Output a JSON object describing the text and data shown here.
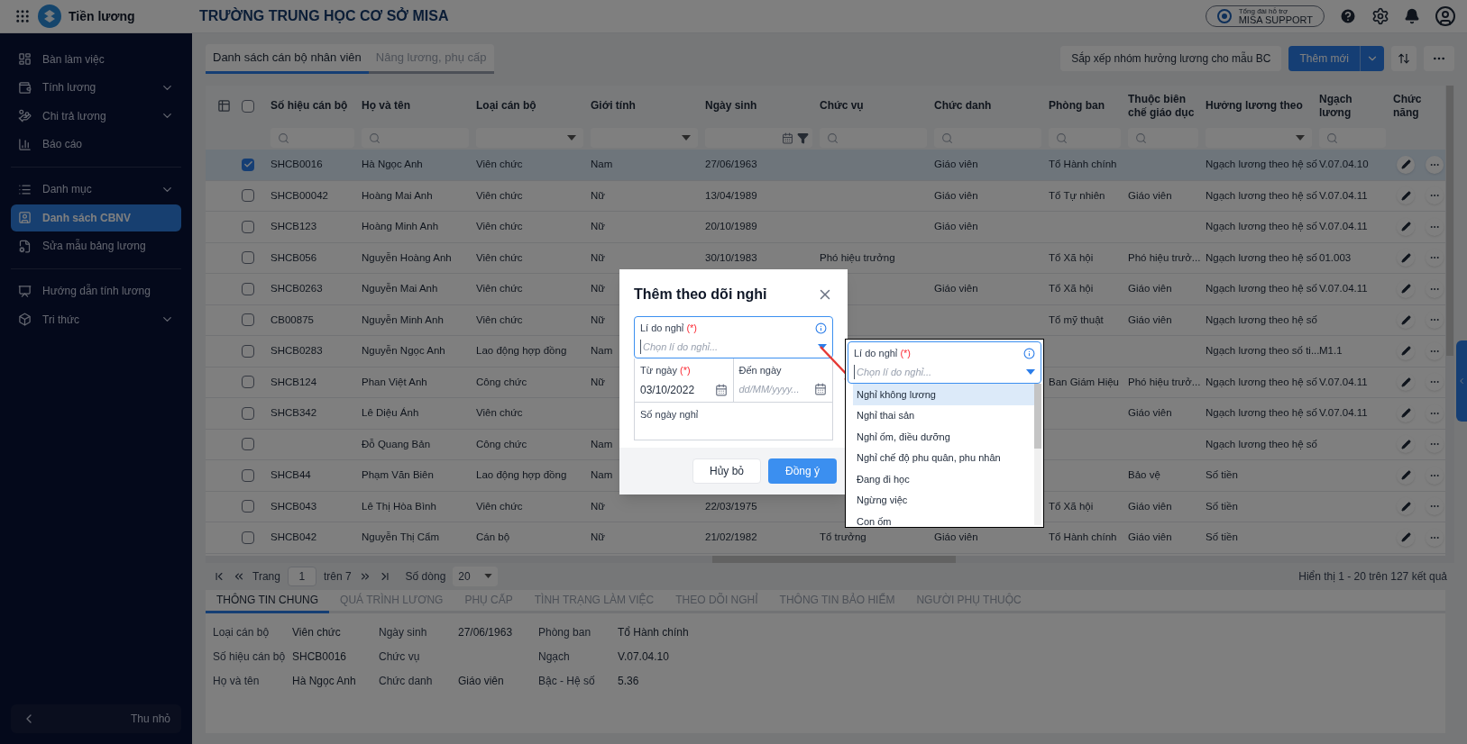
{
  "app": {
    "name": "Tiền lương"
  },
  "school": "TRƯỜNG TRUNG HỌC CƠ SỞ MISA",
  "support": {
    "caption": "Tổng đài hỗ trợ",
    "label": "MISA SUPPORT"
  },
  "sidebar": {
    "sections": [
      [
        {
          "label": "Bàn làm việc",
          "expandable": false,
          "selected": false
        },
        {
          "label": "Tính lương",
          "expandable": true,
          "selected": false
        },
        {
          "label": "Chi trả lương",
          "expandable": true,
          "selected": false
        },
        {
          "label": "Báo cáo",
          "expandable": false,
          "selected": false
        }
      ],
      [
        {
          "label": "Danh mục",
          "expandable": true,
          "selected": false
        },
        {
          "label": "Danh sách CBNV",
          "expandable": false,
          "selected": true
        },
        {
          "label": "Sửa mẫu bảng lương",
          "expandable": false,
          "selected": false
        }
      ],
      [
        {
          "label": "Hướng dẫn tính lương",
          "expandable": false,
          "selected": false
        },
        {
          "label": "Tri thức",
          "expandable": true,
          "selected": false
        }
      ]
    ],
    "collapse": "Thu nhỏ"
  },
  "tabs": [
    {
      "label": "Danh sách cán bộ nhân viên",
      "selected": true
    },
    {
      "label": "Nâng lương, phụ cấp",
      "selected": false
    }
  ],
  "toolbar": {
    "sort_button": "Sắp xếp nhóm hưởng lương cho mẫu BC",
    "add_button": "Thêm mới"
  },
  "table": {
    "columns": [
      {
        "label": "Số hiệu cán bộ",
        "kind": "search"
      },
      {
        "label": "Họ và tên",
        "kind": "search"
      },
      {
        "label": "Loại cán bộ",
        "kind": "select"
      },
      {
        "label": "Giới tính",
        "kind": "select"
      },
      {
        "label": "Ngày sinh",
        "kind": "date"
      },
      {
        "label": "Chức vụ",
        "kind": "search"
      },
      {
        "label": "Chức danh",
        "kind": "search"
      },
      {
        "label": "Phòng ban",
        "kind": "search"
      },
      {
        "label": "Thuộc biên chế giáo dục",
        "kind": "search"
      },
      {
        "label": "Hưởng lương theo",
        "kind": "select"
      },
      {
        "label": "Ngạch lương",
        "kind": "search"
      },
      {
        "label": "Chức năng",
        "kind": "plain"
      }
    ],
    "select_all": {
      "checked": false
    },
    "rows": [
      {
        "checked": true,
        "selected": true,
        "code": "SHCB0016",
        "name": "Hà Ngọc Anh",
        "type": "Viên chức",
        "gender": "Nam",
        "birth": "27/06/1963",
        "title": "Giáo viên",
        "dept": "Tổ Hành chính",
        "basis": "Ngạch lương theo hệ số",
        "grade": "V.07.04.10"
      },
      {
        "checked": false,
        "selected": false,
        "code": "SHCB00042",
        "name": "Hoàng Mai Anh",
        "type": "Viên chức",
        "gender": "Nữ",
        "birth": "13/04/1989",
        "title": "Giáo viên",
        "dept": "Tổ Tự nhiên",
        "unit": "Giáo viên",
        "basis": "Ngạch lương theo hệ số",
        "grade": "V.07.04.11"
      },
      {
        "checked": false,
        "selected": false,
        "code": "SHCB123",
        "name": "Hoàng Minh Anh",
        "type": "Viên chức",
        "gender": "Nữ",
        "birth": "20/10/1989",
        "title": "Giáo viên",
        "basis": "Ngạch lương theo hệ số",
        "grade": "V.07.04.11"
      },
      {
        "checked": false,
        "selected": false,
        "code": "SHCB056",
        "name": "Nguyễn Hoàng Anh",
        "type": "Viên chức",
        "gender": "Nữ",
        "birth": "30/10/1983",
        "position": "Phó hiệu trưởng",
        "dept": "Tổ Xã hội",
        "unit": "Phó hiệu trưở...",
        "basis": "Ngạch lương theo hệ số",
        "grade": "01.003"
      },
      {
        "checked": false,
        "selected": false,
        "code": "SHCB0263",
        "name": "Nguyễn Mai Anh",
        "type": "Viên chức",
        "gender": "Nữ",
        "title": "Giáo viên",
        "dept": "Tổ Xã hội",
        "unit": "Giáo viên",
        "basis": "Ngạch lương theo hệ số",
        "grade": "V.07.04.11"
      },
      {
        "checked": false,
        "selected": false,
        "code": "CB00875",
        "name": "Nguyễn Minh Anh",
        "type": "Viên chức",
        "gender": "Nữ",
        "dept": "Tổ mỹ thuật",
        "unit": "Giáo viên",
        "basis": "Ngạch lương theo hệ số"
      },
      {
        "checked": false,
        "selected": false,
        "code": "SHCB0283",
        "name": "Nguyễn Ngọc Anh",
        "type": "Lao động hợp đồng",
        "gender": "Nam",
        "basis": "Ngạch lương theo số ti...",
        "grade": "M1.1"
      },
      {
        "checked": false,
        "selected": false,
        "code": "SHCB124",
        "name": "Phan Việt Anh",
        "type": "Công chức",
        "gender": "Nữ",
        "dept": "Ban Giám Hiệu",
        "unit": "Phó hiệu trưở...",
        "basis": "Ngạch lương theo hệ số",
        "grade": "V.07.04.11"
      },
      {
        "checked": false,
        "selected": false,
        "code": "SHCB342",
        "name": "Lê Diệu Ánh",
        "type": "Viên chức",
        "unit": "Giáo viên",
        "basis": "Ngạch lương theo hệ số",
        "grade": "V.07.04.11"
      },
      {
        "checked": false,
        "selected": false,
        "name": "Đỗ Quang Bản",
        "type": "Công chức",
        "gender": "Nam",
        "basis": "Ngạch lương theo hệ số"
      },
      {
        "checked": false,
        "selected": false,
        "code": "SHCB44",
        "name": "Phạm Văn Biên",
        "type": "Lao động hợp đồng",
        "gender": "Nam",
        "unit": "Bảo vệ",
        "basis": "Số tiền"
      },
      {
        "checked": false,
        "selected": false,
        "code": "SHCB043",
        "name": "Lê Thị Hòa Bình",
        "type": "Viên chức",
        "gender": "Nữ",
        "birth": "22/03/1975",
        "dept": "Tổ Xã hội",
        "unit": "Giáo viên",
        "basis": "Số tiền"
      },
      {
        "checked": false,
        "selected": false,
        "code": "SHCB042",
        "name": "Nguyễn Thị Cẩm",
        "type": "Cán bộ",
        "gender": "Nữ",
        "birth": "21/02/1982",
        "position": "Tổ trưởng",
        "title": "Giáo viên",
        "dept": "Tổ Hành chính",
        "unit": "Giáo viên",
        "basis": "Số tiền"
      }
    ]
  },
  "pagination": {
    "page_label": "Trang",
    "page": "1",
    "of": "trên 7",
    "rows_label": "Số dòng",
    "rows": "20",
    "summary": "Hiển thị 1 - 20 trên 127 kết quả"
  },
  "detail_tabs": [
    {
      "label": "THÔNG TIN CHUNG",
      "selected": true
    },
    {
      "label": "QUÁ TRÌNH LƯƠNG",
      "selected": false
    },
    {
      "label": "PHỤ CẤP",
      "selected": false
    },
    {
      "label": "TÌNH TRẠNG LÀM VIỆC",
      "selected": false
    },
    {
      "label": "THEO DÕI NGHỈ",
      "selected": false
    },
    {
      "label": "THÔNG TIN BẢO HIỂM",
      "selected": false
    },
    {
      "label": "NGƯỜI PHỤ THUỘC",
      "selected": false
    }
  ],
  "details": [
    {
      "label": "Loại cán bộ",
      "value": "Viên chức"
    },
    {
      "label": "Ngày sinh",
      "value": "27/06/1963"
    },
    {
      "label": "Phòng ban",
      "value": "Tổ Hành chính"
    },
    {
      "label": "Số hiệu cán bộ",
      "value": "SHCB0016"
    },
    {
      "label": "Chức vụ"
    },
    {
      "label": "Ngạch",
      "value": "V.07.04.10"
    },
    {
      "label": "Họ và tên",
      "value": "Hà Ngọc Anh"
    },
    {
      "label": "Chức danh",
      "value": "Giáo viên"
    },
    {
      "label": "Bậc - Hệ số",
      "value": "5.36"
    }
  ],
  "dialog": {
    "title": "Thêm theo dõi nghỉ",
    "reason": {
      "label": "Lí do nghỉ",
      "required": "(*)",
      "placeholder": "Chọn lí do nghỉ..."
    },
    "from": {
      "label": "Từ ngày",
      "required": "(*)",
      "value": "03/10/2022"
    },
    "to": {
      "label": "Đến ngày",
      "placeholder": "dd/MM/yyyy..."
    },
    "days": {
      "label": "Số ngày nghỉ"
    },
    "cancel": "Hủy bỏ",
    "ok": "Đồng ý"
  },
  "callout": {
    "field": {
      "label": "Lí do nghỉ",
      "required": "(*)",
      "placeholder": "Chọn lí do nghỉ..."
    },
    "options": [
      {
        "label": "Nghỉ không lương",
        "selected": true
      },
      {
        "label": "Nghỉ thai sản",
        "selected": false
      },
      {
        "label": "Nghỉ ốm, điều dưỡng",
        "selected": false
      },
      {
        "label": "Nghỉ chế độ phu quân, phu nhân",
        "selected": false
      },
      {
        "label": "Đang đi học",
        "selected": false
      },
      {
        "label": "Ngừng việc",
        "selected": false
      },
      {
        "label": "Con ốm",
        "selected": false
      }
    ]
  }
}
